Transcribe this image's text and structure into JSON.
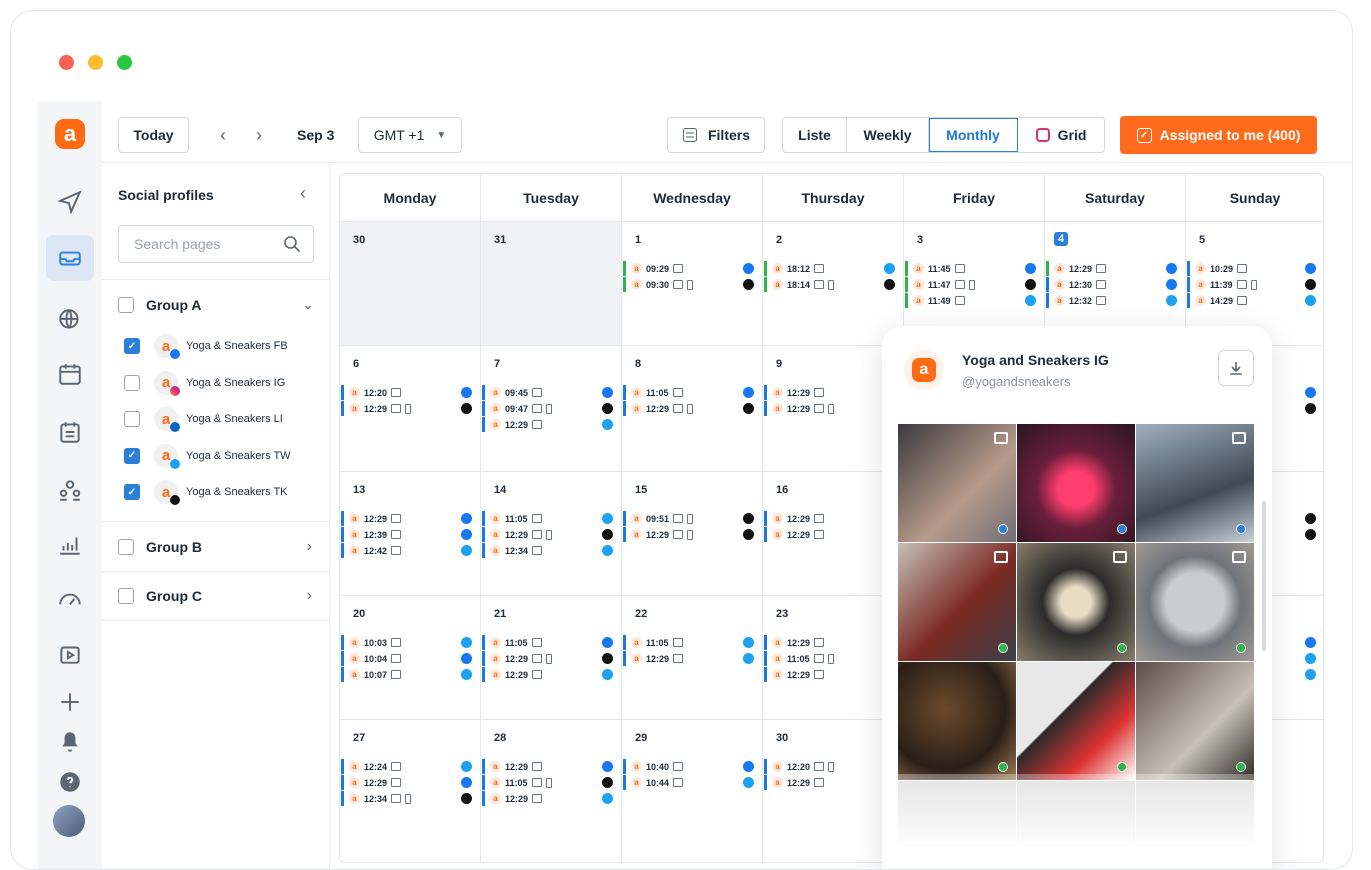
{
  "toolbar": {
    "today": "Today",
    "date": "Sep 3",
    "timezone": "GMT +1",
    "filters": "Filters",
    "views": [
      "Liste",
      "Weekly",
      "Monthly",
      "Grid"
    ],
    "active_view": "Monthly",
    "assigned": "Assigned to me (400)"
  },
  "sidebar": {
    "title": "Social profiles",
    "search_placeholder": "Search pages",
    "groups": [
      {
        "name": "Group A",
        "expanded": true,
        "profiles": [
          {
            "name": "Yoga & Sneakers FB",
            "checked": true,
            "network": "facebook"
          },
          {
            "name": "Yoga & Sneakers IG",
            "checked": false,
            "network": "instagram"
          },
          {
            "name": "Yoga & Sneakers LI",
            "checked": false,
            "network": "linkedin"
          },
          {
            "name": "Yoga & Sneakers TW",
            "checked": true,
            "network": "twitter"
          },
          {
            "name": "Yoga & Sneakers TK",
            "checked": true,
            "network": "tiktok"
          }
        ]
      },
      {
        "name": "Group B",
        "expanded": false
      },
      {
        "name": "Group C",
        "expanded": false
      }
    ]
  },
  "calendar": {
    "days": [
      "Monday",
      "Tuesday",
      "Wednesday",
      "Thursday",
      "Friday",
      "Saturday",
      "Sunday"
    ],
    "weeks": [
      [
        {
          "d": "30",
          "grey": true,
          "posts": []
        },
        {
          "d": "31",
          "grey": true,
          "posts": []
        },
        {
          "d": "1",
          "posts": [
            {
              "t": "09:29",
              "c": "#2fb24f",
              "n": "fb"
            },
            {
              "t": "09:30",
              "c": "#2fb24f",
              "n": "tk",
              "ph": true
            }
          ]
        },
        {
          "d": "2",
          "posts": [
            {
              "t": "18:12",
              "c": "#2fb24f",
              "n": "tw"
            },
            {
              "t": "18:14",
              "c": "#2fb24f",
              "n": "tk",
              "ph": true
            }
          ]
        },
        {
          "d": "3",
          "posts": [
            {
              "t": "11:45",
              "c": "#2fb24f",
              "n": "fb"
            },
            {
              "t": "11:47",
              "c": "#2fb24f",
              "n": "tk",
              "ph": true
            },
            {
              "t": "11:49",
              "c": "#2fb24f",
              "n": "tw"
            }
          ]
        },
        {
          "d": "4",
          "today": true,
          "posts": [
            {
              "t": "12:29",
              "c": "#2fb24f",
              "n": "fb"
            },
            {
              "t": "12:30",
              "c": "#1e78d6",
              "n": "fb"
            },
            {
              "t": "12:32",
              "c": "#1e78d6",
              "n": "tw"
            }
          ]
        },
        {
          "d": "5",
          "posts": [
            {
              "t": "10:29",
              "c": "#1e78d6",
              "n": "fb"
            },
            {
              "t": "11:39",
              "c": "#1e78d6",
              "n": "tk",
              "ph": true
            },
            {
              "t": "14:29",
              "c": "#1e78d6",
              "n": "tw"
            }
          ]
        }
      ],
      [
        {
          "d": "6",
          "posts": [
            {
              "t": "12:20",
              "c": "#1e78d6",
              "n": "fb"
            },
            {
              "t": "12:29",
              "c": "#1e78d6",
              "n": "tk",
              "ph": true
            }
          ]
        },
        {
          "d": "7",
          "posts": [
            {
              "t": "09:45",
              "c": "#1e78d6",
              "n": "fb"
            },
            {
              "t": "09:47",
              "c": "#1e78d6",
              "n": "tk",
              "ph": true
            },
            {
              "t": "12:29",
              "c": "#1e78d6",
              "n": "tw"
            }
          ]
        },
        {
          "d": "8",
          "posts": [
            {
              "t": "11:05",
              "c": "#1e78d6",
              "n": "fb"
            },
            {
              "t": "12:29",
              "c": "#1e78d6",
              "n": "tk",
              "ph": true
            }
          ]
        },
        {
          "d": "9",
          "posts": [
            {
              "t": "12:29",
              "c": "#1e78d6"
            },
            {
              "t": "12:29",
              "c": "#1e78d6",
              "ph": true
            }
          ]
        },
        {
          "d": "",
          "posts": []
        },
        {
          "d": "",
          "posts": []
        },
        {
          "d": "",
          "posts": [
            {
              "t": "",
              "n": "fb"
            },
            {
              "t": "",
              "n": "tk"
            }
          ]
        }
      ],
      [
        {
          "d": "13",
          "posts": [
            {
              "t": "12:29",
              "c": "#1e78d6",
              "n": "fb"
            },
            {
              "t": "12:39",
              "c": "#1e78d6",
              "n": "fb"
            },
            {
              "t": "12:42",
              "c": "#1e78d6",
              "n": "tw"
            }
          ]
        },
        {
          "d": "14",
          "posts": [
            {
              "t": "11:05",
              "c": "#1e78d6",
              "n": "tw"
            },
            {
              "t": "12:29",
              "c": "#1e78d6",
              "n": "tk",
              "ph": true
            },
            {
              "t": "12:34",
              "c": "#1e78d6",
              "n": "tw"
            }
          ]
        },
        {
          "d": "15",
          "posts": [
            {
              "t": "09:51",
              "c": "#1e78d6",
              "n": "tk",
              "ph": true
            },
            {
              "t": "12:29",
              "c": "#1e78d6",
              "n": "tk",
              "ph": true
            }
          ]
        },
        {
          "d": "16",
          "posts": [
            {
              "t": "12:29",
              "c": "#1e78d6"
            },
            {
              "t": "12:29",
              "c": "#1e78d6"
            }
          ]
        },
        {
          "d": "",
          "posts": []
        },
        {
          "d": "",
          "posts": []
        },
        {
          "d": "",
          "posts": [
            {
              "t": "",
              "n": "tk"
            },
            {
              "t": "",
              "n": "tk"
            }
          ]
        }
      ],
      [
        {
          "d": "20",
          "posts": [
            {
              "t": "10:03",
              "c": "#1e78d6",
              "n": "tw"
            },
            {
              "t": "10:04",
              "c": "#1e78d6",
              "n": "fb"
            },
            {
              "t": "10:07",
              "c": "#1e78d6",
              "n": "tw"
            }
          ]
        },
        {
          "d": "21",
          "posts": [
            {
              "t": "11:05",
              "c": "#1e78d6",
              "n": "fb"
            },
            {
              "t": "12:29",
              "c": "#1e78d6",
              "n": "tk",
              "ph": true
            },
            {
              "t": "12:29",
              "c": "#1e78d6",
              "n": "tw"
            }
          ]
        },
        {
          "d": "22",
          "posts": [
            {
              "t": "11:05",
              "c": "#1e78d6",
              "n": "tw"
            },
            {
              "t": "12:29",
              "c": "#1e78d6",
              "n": "tw"
            }
          ]
        },
        {
          "d": "23",
          "posts": [
            {
              "t": "12:29",
              "c": "#1e78d6"
            },
            {
              "t": "11:05",
              "c": "#1e78d6",
              "ph": true
            },
            {
              "t": "12:29",
              "c": "#1e78d6"
            }
          ]
        },
        {
          "d": "",
          "posts": []
        },
        {
          "d": "",
          "posts": []
        },
        {
          "d": "",
          "posts": [
            {
              "t": "",
              "n": "fb"
            },
            {
              "t": "",
              "n": "tw"
            },
            {
              "t": "",
              "n": "tw"
            }
          ]
        }
      ],
      [
        {
          "d": "27",
          "posts": [
            {
              "t": "12:24",
              "c": "#1e78d6",
              "n": "tw"
            },
            {
              "t": "12:29",
              "c": "#1e78d6",
              "n": "fb"
            },
            {
              "t": "12:34",
              "c": "#1e78d6",
              "n": "tk",
              "ph": true
            }
          ]
        },
        {
          "d": "28",
          "posts": [
            {
              "t": "12:29",
              "c": "#1e78d6",
              "n": "fb"
            },
            {
              "t": "11:05",
              "c": "#1e78d6",
              "n": "tk",
              "ph": true
            },
            {
              "t": "12:29",
              "c": "#1e78d6",
              "n": "tw"
            }
          ]
        },
        {
          "d": "29",
          "posts": [
            {
              "t": "10:40",
              "c": "#1e78d6",
              "n": "fb"
            },
            {
              "t": "10:44",
              "c": "#1e78d6",
              "n": "tw"
            }
          ]
        },
        {
          "d": "30",
          "posts": [
            {
              "t": "12:20",
              "c": "#1e78d6",
              "ph": true
            },
            {
              "t": "12:29",
              "c": "#1e78d6"
            }
          ]
        },
        {
          "d": "",
          "posts": []
        },
        {
          "d": "",
          "posts": []
        },
        {
          "d": "",
          "posts": []
        }
      ]
    ]
  },
  "panel": {
    "name": "Yoga and Sneakers IG",
    "handle": "@yogandsneakers",
    "images": [
      {
        "label": "yoga class",
        "bg": "linear-gradient(135deg,#3b3a3f,#b79b8a 60%,#6f6d77)",
        "dot": "#2b7fdb",
        "icon": "multi"
      },
      {
        "label": "neon sneaker",
        "bg": "radial-gradient(circle at 50% 55%,#ff3d6e 0 20%,#6a1f3a 45%,#2a1520)",
        "dot": "#2b7fdb"
      },
      {
        "label": "sneakers ledge",
        "bg": "linear-gradient(160deg,#9fb0bf,#3f4a55 60%,#c8d0d8)",
        "dot": "#2b7fdb",
        "icon": "multi"
      },
      {
        "label": "converse cap",
        "bg": "linear-gradient(135deg,#c4c0b8,#7b2a22 55%,#3b3f47)",
        "dot": "#2fb24f",
        "icon": "video"
      },
      {
        "label": "jordan laces",
        "bg": "radial-gradient(circle at 50% 50%,#e8dcc4 0 18%,#2b2b2b 40%,#8a7e6b)",
        "dot": "#2fb24f",
        "icon": "video"
      },
      {
        "label": "clock",
        "bg": "radial-gradient(circle at 50% 50%,#c9ccd1 0 35%,#6f747b 55%,#a09a94)",
        "dot": "#2fb24f",
        "icon": "video"
      },
      {
        "label": "ramen",
        "bg": "radial-gradient(circle at 40% 40%,#6b4a2c,#2a1f17 60%,#a17b56)",
        "dot": "#2fb24f"
      },
      {
        "label": "sneaker red",
        "bg": "linear-gradient(135deg,#e8e8e8 40%,#2b2b2b 41%,#d33 70%,#fff)",
        "dot": "#2fb24f"
      },
      {
        "label": "cafe",
        "bg": "linear-gradient(135deg,#5a4e46,#c8c0b5 60%,#2e2a28)",
        "dot": "#2fb24f"
      }
    ]
  }
}
